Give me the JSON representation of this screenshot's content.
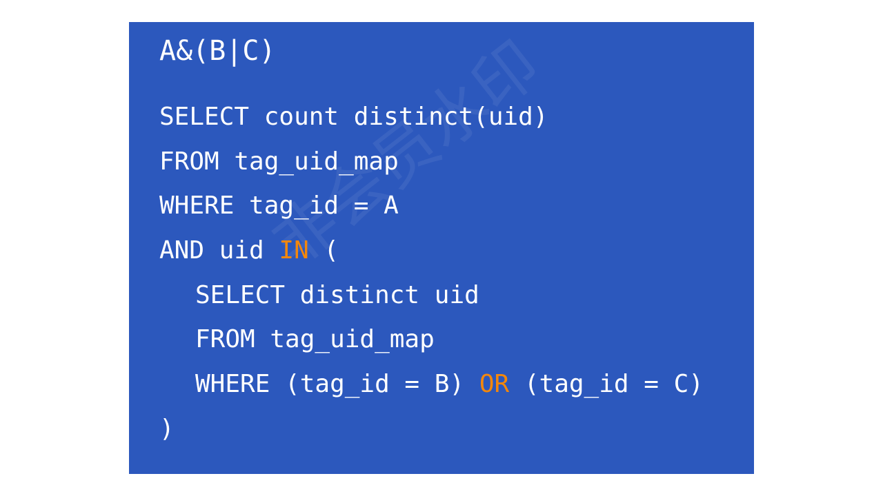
{
  "slide": {
    "title": "A&(B|C)",
    "watermark": "非会员水印",
    "colors": {
      "background": "#2c58bd",
      "text": "#ffffff",
      "highlight": "#f3870c"
    },
    "lines": [
      {
        "text": "SELECT count distinct(uid)"
      },
      {
        "text": "FROM tag_uid_map"
      },
      {
        "text": "WHERE tag_id = A"
      },
      {
        "pre": "AND uid ",
        "highlight": "IN",
        "post": " ("
      },
      {
        "text": "SELECT distinct uid"
      },
      {
        "text": "FROM tag_uid_map"
      },
      {
        "pre": "WHERE (tag_id = B) ",
        "highlight": "OR",
        "post": " (tag_id = C)"
      },
      {
        "text": ")"
      }
    ]
  }
}
